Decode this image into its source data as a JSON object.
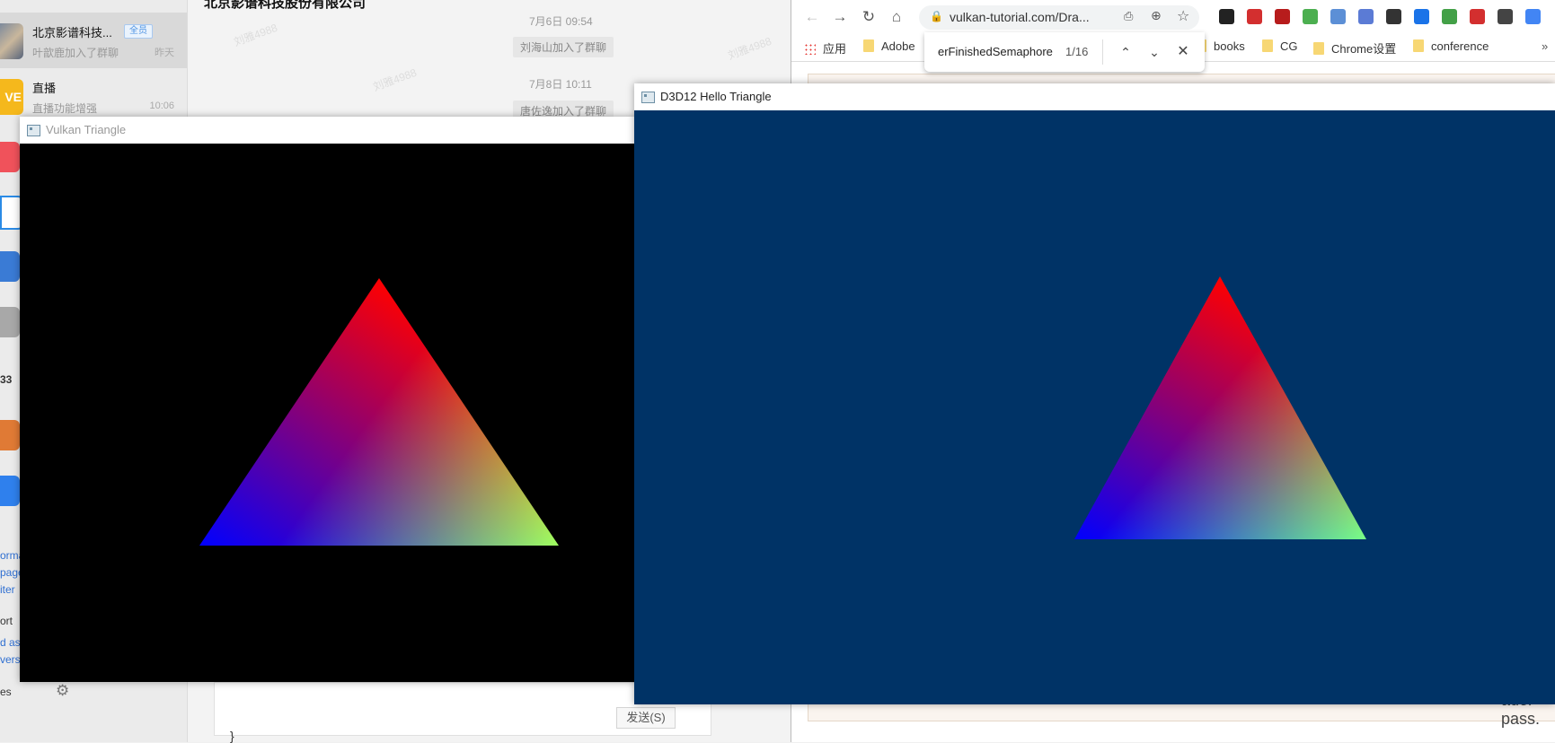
{
  "chat_app": {
    "conversations": [
      {
        "name": "北京影谱科技...",
        "badge": "全员",
        "last_message": "叶歆鹿加入了群聊",
        "time": "昨天"
      },
      {
        "name": "直播",
        "last_message": "直播功能增强",
        "time": "10:06",
        "avatar_text": "VE"
      }
    ],
    "side_snippets": [
      "33",
      "orma",
      "page",
      "iter",
      "ort",
      "d as",
      "vers",
      "es"
    ],
    "chat_title": "北京影谱科技股份有限公司",
    "messages": [
      {
        "time": "7月6日 09:54",
        "text": "刘海山加入了群聊"
      },
      {
        "time": "7月8日 10:11",
        "text": "唐佐逸加入了群聊"
      }
    ],
    "watermark": "刘雅4988",
    "send_label": "发送(S)",
    "colors": {
      "accent": "#4a90e2",
      "background": "#f3f3f3"
    }
  },
  "browser": {
    "url": "vulkan-tutorial.com/Dra...",
    "extensions": [
      {
        "icon": "ext-dark-icon",
        "color": "#222"
      },
      {
        "icon": "opera-icon",
        "color": "#d32f2f"
      },
      {
        "icon": "pdf-icon",
        "color": "#b71c1c"
      },
      {
        "icon": "color-picker-icon",
        "color": "#4caf50"
      },
      {
        "icon": "feather-icon",
        "color": "#5c8fd6"
      },
      {
        "icon": "jh-icon",
        "color": "#5b7bd5"
      },
      {
        "icon": "incognito-icon",
        "color": "#333"
      },
      {
        "icon": "plus-icon",
        "color": "#1a73e8"
      },
      {
        "icon": "arrow-icon",
        "color": "#43a047"
      },
      {
        "icon": "gift-icon",
        "color": "#d32f2f"
      },
      {
        "icon": "translate-icon",
        "color": "#444"
      },
      {
        "icon": "google-translate-icon",
        "color": "#4285f4"
      }
    ],
    "bookmarks": {
      "apps_label": "应用",
      "items": [
        "Adobe",
        "books",
        "CG",
        "Chrome设置",
        "conference"
      ]
    },
    "find_bar": {
      "query": "erFinishedSemaphore",
      "count": "1/16"
    },
    "page_fragment": "ader pass."
  },
  "vulkan_window": {
    "title": "Vulkan Triangle",
    "background": "#000000",
    "vertex_colors": {
      "top": "#ff0000",
      "bottom_left": "#0000ff",
      "bottom_right": "#00ff00"
    }
  },
  "d3d12_window": {
    "title": "D3D12 Hello Triangle",
    "background": "#003366",
    "vertex_colors": {
      "top": "#ff0000",
      "bottom_left": "#0000ff",
      "bottom_right": "#00ff00"
    }
  }
}
